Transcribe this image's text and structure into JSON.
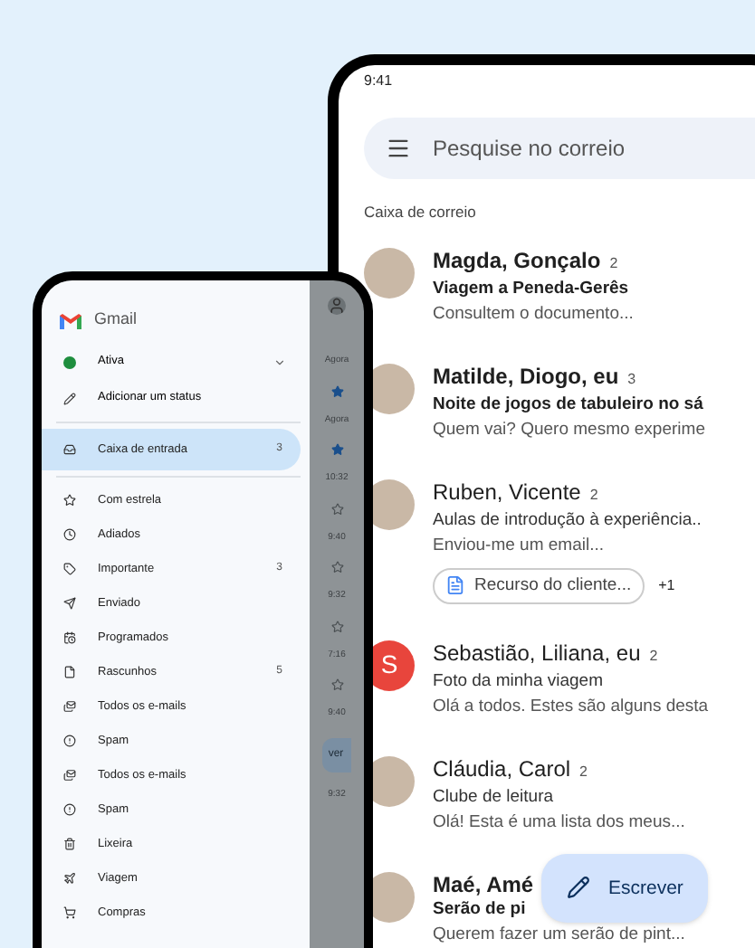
{
  "big_phone": {
    "status_time": "9:41",
    "search": {
      "placeholder": "Pesquise no correio"
    },
    "section_label": "Caixa de correio",
    "emails": [
      {
        "sender": "Magda, Gonçalo",
        "count": "2",
        "subject": "Viagem a Peneda-Gerês",
        "preview": "Consultem o documento...",
        "unread": true,
        "avatar": {
          "kind": "photo"
        }
      },
      {
        "sender": "Matilde, Diogo, eu",
        "count": "3",
        "subject": "Noite de jogos de tabuleiro no sá",
        "preview": "Quem vai? Quero mesmo experime",
        "unread": true,
        "avatar": {
          "kind": "photo"
        }
      },
      {
        "sender": "Ruben, Vicente",
        "count": "2",
        "subject": "Aulas de introdução à experiência..",
        "preview": "Enviou-me um email...",
        "unread": false,
        "avatar": {
          "kind": "photo"
        },
        "attachment": {
          "name": "Recurso do cliente...",
          "more": "+1"
        }
      },
      {
        "sender": "Sebastião, Liliana, eu",
        "count": "2",
        "subject": "Foto da minha viagem",
        "preview": "Olá a todos. Estes são alguns desta",
        "unread": false,
        "avatar": {
          "kind": "letter",
          "letter": "S",
          "color": "#e8453c"
        }
      },
      {
        "sender": "Cláudia, Carol",
        "count": "2",
        "subject": "Clube de leitura",
        "preview": "Olá! Esta é uma lista dos meus...",
        "unread": false,
        "avatar": {
          "kind": "photo"
        }
      },
      {
        "sender": "Maé, Amé",
        "subject": "Serão de pi",
        "preview": "Querem fazer um serão de pint...",
        "unread": true,
        "avatar": {
          "kind": "photo"
        }
      }
    ],
    "compose": {
      "label": "Escrever"
    }
  },
  "small_phone": {
    "app_name": "Gmail",
    "status": {
      "label": "Ativa",
      "color": "#1e8e3e"
    },
    "add_status": "Adicionar um status",
    "folders": [
      {
        "kind": "inbox",
        "label": "Caixa de entrada",
        "count": "3",
        "selected": true
      },
      {
        "kind": "star",
        "label": "Com estrela",
        "selected": false
      },
      {
        "kind": "clock",
        "label": "Adiados",
        "selected": false
      },
      {
        "kind": "important",
        "label": "Importante",
        "count": "3",
        "selected": false
      },
      {
        "kind": "send",
        "label": "Enviado",
        "selected": false
      },
      {
        "kind": "scheduled",
        "label": "Programados",
        "selected": false
      },
      {
        "kind": "draft",
        "label": "Rascunhos",
        "count": "5",
        "selected": false
      },
      {
        "kind": "all-mail",
        "label": "Todos os e-mails",
        "selected": false
      },
      {
        "kind": "spam",
        "label": "Spam",
        "selected": false
      },
      {
        "kind": "all-mail",
        "label": "Todos os e-mails",
        "selected": false
      },
      {
        "kind": "spam",
        "label": "Spam",
        "selected": false
      },
      {
        "kind": "trash",
        "label": "Lixeira",
        "selected": false
      },
      {
        "kind": "plane",
        "label": "Viagem",
        "selected": false
      },
      {
        "kind": "cart",
        "label": "Compras",
        "selected": false
      }
    ],
    "behind": [
      {
        "kind": "time",
        "text": "Agora"
      },
      {
        "kind": "star",
        "starred": true
      },
      {
        "kind": "time",
        "text": "Agora"
      },
      {
        "kind": "star",
        "starred": true
      },
      {
        "kind": "time",
        "text": "10:32"
      },
      {
        "kind": "star",
        "starred": false
      },
      {
        "kind": "time",
        "text": "9:40"
      },
      {
        "kind": "star",
        "starred": false
      },
      {
        "kind": "time",
        "text": "9:32"
      },
      {
        "kind": "star",
        "starred": false
      },
      {
        "kind": "time",
        "text": "7:16"
      },
      {
        "kind": "star",
        "starred": false
      },
      {
        "kind": "time",
        "text": "9:40"
      },
      {
        "kind": "compose",
        "text": "ver"
      },
      {
        "kind": "time",
        "text": "9:32"
      }
    ]
  }
}
